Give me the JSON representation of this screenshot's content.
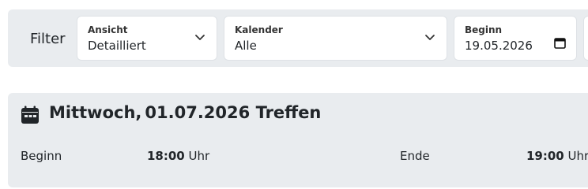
{
  "filter": {
    "title": "Filter",
    "view": {
      "label": "Ansicht",
      "value": "Detailliert"
    },
    "calendar": {
      "label": "Kalender",
      "value": "Alle"
    },
    "start": {
      "label": "Beginn",
      "value": "19.05.2026"
    }
  },
  "event": {
    "weekday": "Mittwoch,",
    "date": "01.07.2026",
    "name": "Treffen",
    "start_label": "Beginn",
    "start_time": "18:00",
    "start_unit": "Uhr",
    "end_label": "Ende",
    "end_time": "19:00",
    "end_unit": "Uhr"
  },
  "icons": {
    "view_chevron": "chevron-down-icon",
    "calendar_chevron": "chevron-down-icon",
    "date_picker": "calendar-icon",
    "event": "calendar-icon"
  }
}
